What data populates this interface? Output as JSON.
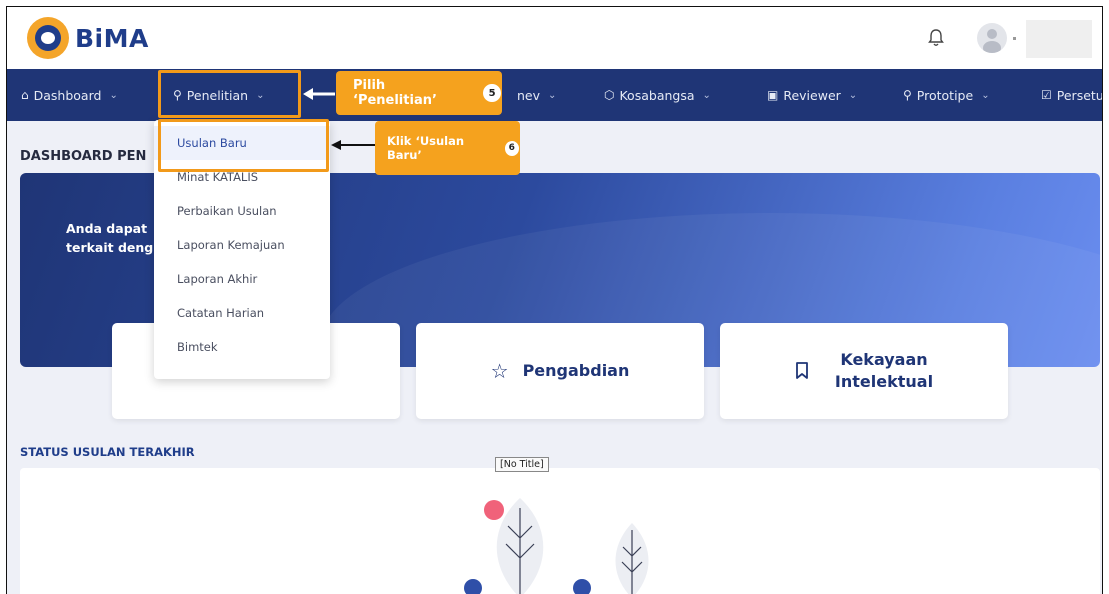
{
  "header": {
    "logo_text": "BiMA"
  },
  "navbar": {
    "items": [
      {
        "icon": "⌂",
        "label": "Dashboard"
      },
      {
        "icon": "⚲",
        "label": "Penelitian"
      },
      {
        "icon": "",
        "label": "nev"
      },
      {
        "icon": "⬡",
        "label": "Kosabangsa"
      },
      {
        "icon": "▣",
        "label": "Reviewer"
      },
      {
        "icon": "⚲",
        "label": "Prototipe"
      },
      {
        "icon": "☑",
        "label": "Persetu"
      }
    ]
  },
  "main": {
    "page_title": "DASHBOARD PEN",
    "banner_line1": "Anda dapat",
    "banner_line2": "terkait deng",
    "cards": [
      {
        "label": "Pengabdian",
        "icon": "star-icon"
      },
      {
        "label_line1": "Kekayaan",
        "label_line2": "Intelektual",
        "icon": "bookmark-icon"
      }
    ],
    "status_title": "STATUS USULAN TERAKHIR",
    "tooltip": "[No Title]"
  },
  "dropdown": {
    "items": [
      "Usulan Baru",
      "Minat KATALIS",
      "Perbaikan Usulan",
      "Laporan Kemajuan",
      "Laporan Akhir",
      "Catatan Harian",
      "Bimtek"
    ]
  },
  "annotations": {
    "step5": {
      "text": "Pilih ‘Penelitian’",
      "number": "5"
    },
    "step6": {
      "text": "Klik ‘Usulan Baru’",
      "number": "6"
    }
  },
  "colors": {
    "navbar": "#1f3576",
    "highlight": "#f29a1a",
    "primary": "#1f3d8a"
  }
}
